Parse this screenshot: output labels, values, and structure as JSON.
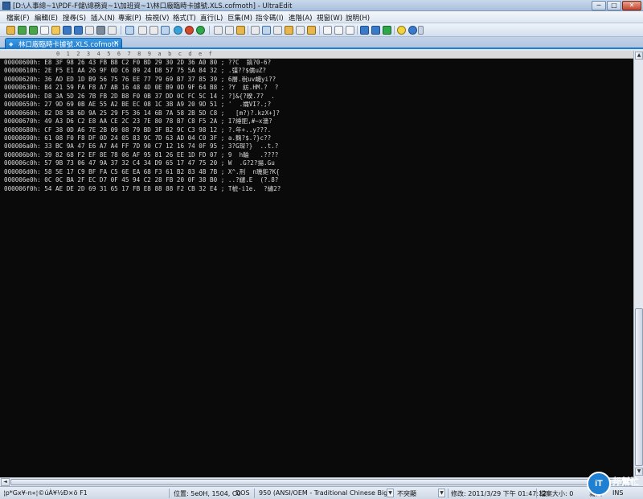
{
  "window": {
    "title": "[D:\\人事總~1\\PDF-F儲\\總務資~1\\加班資~1\\林口廠臨時卡據號.XLS.cofmoth] - UltraEdit",
    "minimize_glyph": "─",
    "maximize_glyph": "□",
    "close_glyph": "✕"
  },
  "menu": [
    "檔案(F)",
    "編輯(E)",
    "搜尋(S)",
    "插入(N)",
    "專案(P)",
    "檢視(V)",
    "格式(T)",
    "直行(L)",
    "巨集(M)",
    "指令碼(I)",
    "進階(A)",
    "視窗(W)",
    "說明(H)"
  ],
  "tab": {
    "label": "林口廠臨時卡據號.XLS.cofmoth",
    "close_glyph": "×",
    "grip_glyph": "◆"
  },
  "ruler_text": "0  1  2  3  4  5  6  7  8  9  a  b  c  d  e  f",
  "hex_lines": [
    "00000600h: E8 3F 98 26 43 FB B8 C2 F0 BD 29 30 2D 36 A0 80 ; ??C  鎬?0-6?",
    "00000610h: 2E F5 E1 AA 26 9F 0D C6 89 24 D8 57 75 5A 84 32 ; .彊??$儒uZ?",
    "00000620h: 36 AD ED 1D B9 56 75 76 EE 77 79 69 B7 37 85 39 ; 6層.稅uv衊yi??",
    "00000630h: B4 21 59 FA F8 A7 AB 16 48 4D 0E B9 0D 9F 64 B8 ; ?Y  紡.HM.?  ?",
    "00000640h: D8 3A 5D 26 7B FB 2D B8 F0 0B 37 DD 0C FC 5C 14 ; ?]&{?暌.7?  .",
    "00000650h: 27 9D 69 0B AE 55 A2 BE EC 08 1C 3B A9 20 9D 51 ; '  .孀VI?.;?",
    "00000660h: 82 D8 5B 6D 9A 25 29 F5 36 14 6B 7A 58 2B 5D C8 ;   [m?)?.kzX+]?",
    "00000670h: 49 A3 D6 C2 E8 AA CE 2C 23 7E 80 78 B7 C8 F5 2A ; I?綞肥,#~x濇?",
    "00000680h: CF 38 0D A6 7E 2B 09 08 79 BD 3F B2 9C C3 98 12 ; ?.年+..y???.",
    "00000690h: 61 08 F0 F8 DF 0D 24 05 83 9C 7D 63 AD 04 C0 3F ; a.麴?$.?}c??",
    "000006a0h: 33 BC 9A 47 E6 A7 A4 FF 7D 90 C7 12 16 74 0F 95 ; 3?G琛?}  ..t.?",
    "000006b0h: 39 82 68 F2 EF 8E 78 06 AF 95 81 26 EE 1D FD 07 ; 9  h輪   .????",
    "000006c0h: 57 9B 73 06 47 9A 37 32 C4 34 D9 65 17 47 75 20 ; W  .G?2?揚.Gu",
    "000006d0h: 58 5E 17 C9 BF FA C5 6E EA 68 F3 61 B2 83 4B 7B ; X^.刑  n璣鉅?K{",
    "000006e0h: 0C 0C BA 2F EC D7 0F 45 94 C2 28 FB 20 0F 38 B0 ; ..?繾.E  (?.8?",
    "000006f0h: 54 AE DE 2D 69 31 65 17 FB E8 88 88 F2 CB 32 E4 ; T椃-i1e.  ?繡2?"
  ],
  "status": {
    "encoded_text": "¦p*Gx¥-n«¦©úÀ¥½Ð×ö F1",
    "position": "位置: 5e0H, 1504, C0",
    "line_ending": "DOS",
    "codepage": "950  (ANSI/OEM - Traditional Chinese Big5)",
    "highlight": "不突顯",
    "modified": "修改: 2011/3/29 下午 01:47:12",
    "file_size": "檔案大小: 0",
    "insert_mode": "寫入",
    "ins": "INS",
    "dropdown_glyph": "▼"
  },
  "watermark": {
    "logo_text": "iT",
    "brand_text": "邦幫忙"
  },
  "scrollbar": {
    "up_glyph": "▲",
    "down_glyph": "▼",
    "left_glyph": "◄",
    "right_glyph": "►"
  }
}
